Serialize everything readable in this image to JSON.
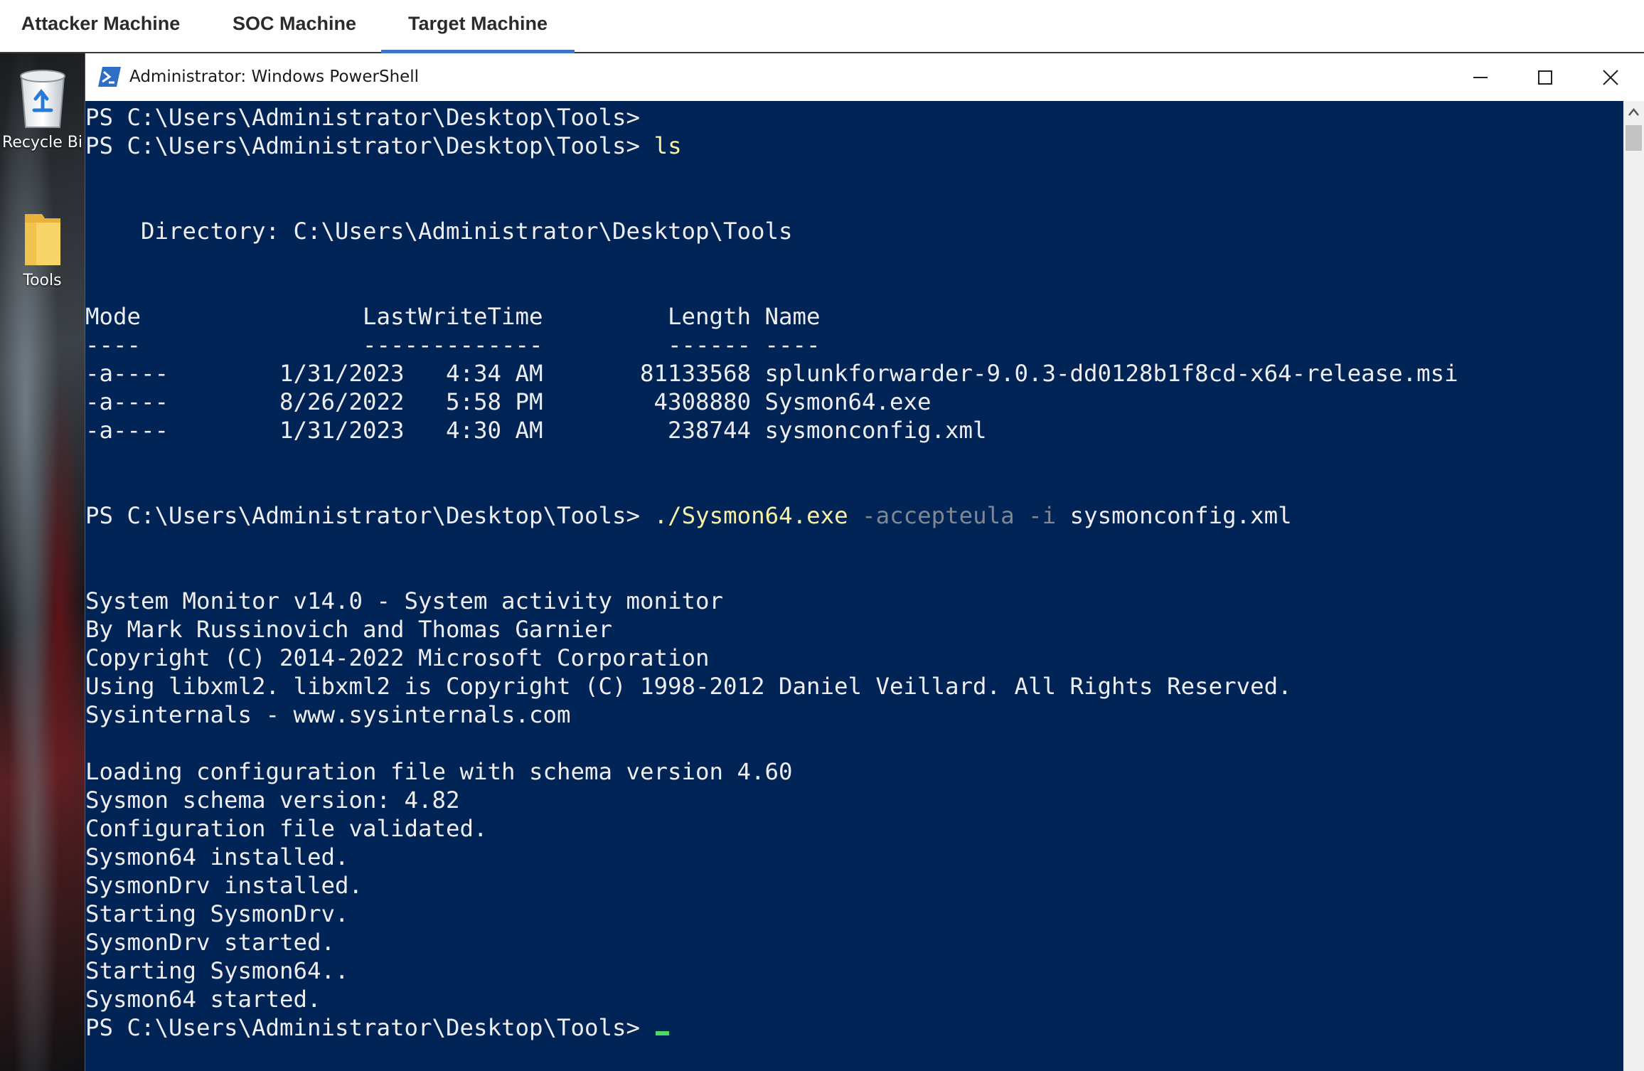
{
  "tabs": [
    {
      "label": "Attacker Machine"
    },
    {
      "label": "SOC Machine"
    },
    {
      "label": "Target Machine",
      "active": true
    }
  ],
  "desktop": {
    "icons": [
      {
        "label": "Recycle Bi",
        "icon": "recycle-bin-icon"
      },
      {
        "label": "Tools",
        "icon": "folder-icon"
      }
    ]
  },
  "window": {
    "title": "Administrator: Windows PowerShell",
    "icon": "powershell-icon",
    "controls": [
      "minimize-icon",
      "maximize-icon",
      "close-icon"
    ]
  },
  "console": {
    "prompt": "PS C:\\Users\\Administrator\\Desktop\\Tools>",
    "commands": {
      "ls": "ls",
      "sysmon_exe": "./Sysmon64.exe",
      "sysmon_param1": "-accepteula",
      "sysmon_param2": "-i",
      "sysmon_arg": "sysmonconfig.xml"
    },
    "directory_line": "    Directory: C:\\Users\\Administrator\\Desktop\\Tools",
    "listing": {
      "header": "Mode                LastWriteTime         Length Name",
      "underline": "----                -------------         ------ ----",
      "rows": [
        "-a----        1/31/2023   4:34 AM       81133568 splunkforwarder-9.0.3-dd0128b1f8cd-x64-release.msi",
        "-a----        8/26/2022   5:58 PM        4308880 Sysmon64.exe",
        "-a----        1/31/2023   4:30 AM         238744 sysmonconfig.xml"
      ]
    },
    "banner": [
      "System Monitor v14.0 - System activity monitor",
      "By Mark Russinovich and Thomas Garnier",
      "Copyright (C) 2014-2022 Microsoft Corporation",
      "Using libxml2. libxml2 is Copyright (C) 1998-2012 Daniel Veillard. All Rights Reserved.",
      "Sysinternals - www.sysinternals.com"
    ],
    "install_output": [
      "Loading configuration file with schema version 4.60",
      "Sysmon schema version: 4.82",
      "Configuration file validated.",
      "Sysmon64 installed.",
      "SysmonDrv installed.",
      "Starting SysmonDrv.",
      "SysmonDrv started.",
      "Starting Sysmon64..",
      "Sysmon64 started."
    ]
  },
  "colors": {
    "console_bg": "#012456",
    "console_fg": "#eeedf0",
    "command": "#f9f1a5",
    "parameter": "#7f8793",
    "tab_accent": "#3f74c6"
  }
}
